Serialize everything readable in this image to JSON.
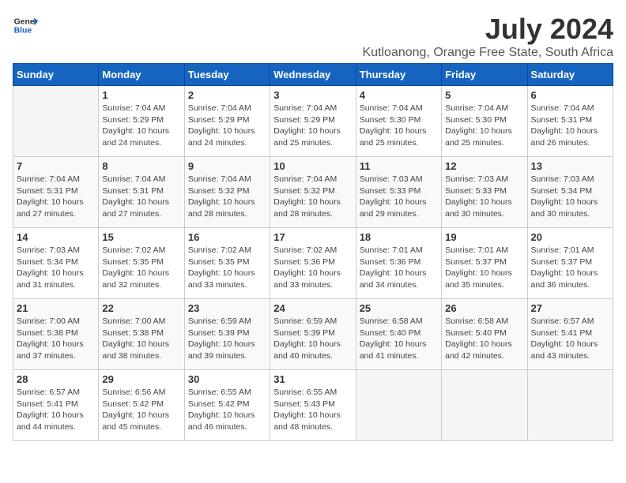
{
  "header": {
    "logo_general": "General",
    "logo_blue": "Blue",
    "main_title": "July 2024",
    "subtitle": "Kutloanong, Orange Free State, South Africa"
  },
  "days_of_week": [
    "Sunday",
    "Monday",
    "Tuesday",
    "Wednesday",
    "Thursday",
    "Friday",
    "Saturday"
  ],
  "weeks": [
    [
      {
        "day": "",
        "sunrise": "",
        "sunset": "",
        "daylight": ""
      },
      {
        "day": "1",
        "sunrise": "Sunrise: 7:04 AM",
        "sunset": "Sunset: 5:29 PM",
        "daylight": "Daylight: 10 hours and 24 minutes."
      },
      {
        "day": "2",
        "sunrise": "Sunrise: 7:04 AM",
        "sunset": "Sunset: 5:29 PM",
        "daylight": "Daylight: 10 hours and 24 minutes."
      },
      {
        "day": "3",
        "sunrise": "Sunrise: 7:04 AM",
        "sunset": "Sunset: 5:29 PM",
        "daylight": "Daylight: 10 hours and 25 minutes."
      },
      {
        "day": "4",
        "sunrise": "Sunrise: 7:04 AM",
        "sunset": "Sunset: 5:30 PM",
        "daylight": "Daylight: 10 hours and 25 minutes."
      },
      {
        "day": "5",
        "sunrise": "Sunrise: 7:04 AM",
        "sunset": "Sunset: 5:30 PM",
        "daylight": "Daylight: 10 hours and 25 minutes."
      },
      {
        "day": "6",
        "sunrise": "Sunrise: 7:04 AM",
        "sunset": "Sunset: 5:31 PM",
        "daylight": "Daylight: 10 hours and 26 minutes."
      }
    ],
    [
      {
        "day": "7",
        "sunrise": "Sunrise: 7:04 AM",
        "sunset": "Sunset: 5:31 PM",
        "daylight": "Daylight: 10 hours and 27 minutes."
      },
      {
        "day": "8",
        "sunrise": "Sunrise: 7:04 AM",
        "sunset": "Sunset: 5:31 PM",
        "daylight": "Daylight: 10 hours and 27 minutes."
      },
      {
        "day": "9",
        "sunrise": "Sunrise: 7:04 AM",
        "sunset": "Sunset: 5:32 PM",
        "daylight": "Daylight: 10 hours and 28 minutes."
      },
      {
        "day": "10",
        "sunrise": "Sunrise: 7:04 AM",
        "sunset": "Sunset: 5:32 PM",
        "daylight": "Daylight: 10 hours and 28 minutes."
      },
      {
        "day": "11",
        "sunrise": "Sunrise: 7:03 AM",
        "sunset": "Sunset: 5:33 PM",
        "daylight": "Daylight: 10 hours and 29 minutes."
      },
      {
        "day": "12",
        "sunrise": "Sunrise: 7:03 AM",
        "sunset": "Sunset: 5:33 PM",
        "daylight": "Daylight: 10 hours and 30 minutes."
      },
      {
        "day": "13",
        "sunrise": "Sunrise: 7:03 AM",
        "sunset": "Sunset: 5:34 PM",
        "daylight": "Daylight: 10 hours and 30 minutes."
      }
    ],
    [
      {
        "day": "14",
        "sunrise": "Sunrise: 7:03 AM",
        "sunset": "Sunset: 5:34 PM",
        "daylight": "Daylight: 10 hours and 31 minutes."
      },
      {
        "day": "15",
        "sunrise": "Sunrise: 7:02 AM",
        "sunset": "Sunset: 5:35 PM",
        "daylight": "Daylight: 10 hours and 32 minutes."
      },
      {
        "day": "16",
        "sunrise": "Sunrise: 7:02 AM",
        "sunset": "Sunset: 5:35 PM",
        "daylight": "Daylight: 10 hours and 33 minutes."
      },
      {
        "day": "17",
        "sunrise": "Sunrise: 7:02 AM",
        "sunset": "Sunset: 5:36 PM",
        "daylight": "Daylight: 10 hours and 33 minutes."
      },
      {
        "day": "18",
        "sunrise": "Sunrise: 7:01 AM",
        "sunset": "Sunset: 5:36 PM",
        "daylight": "Daylight: 10 hours and 34 minutes."
      },
      {
        "day": "19",
        "sunrise": "Sunrise: 7:01 AM",
        "sunset": "Sunset: 5:37 PM",
        "daylight": "Daylight: 10 hours and 35 minutes."
      },
      {
        "day": "20",
        "sunrise": "Sunrise: 7:01 AM",
        "sunset": "Sunset: 5:37 PM",
        "daylight": "Daylight: 10 hours and 36 minutes."
      }
    ],
    [
      {
        "day": "21",
        "sunrise": "Sunrise: 7:00 AM",
        "sunset": "Sunset: 5:38 PM",
        "daylight": "Daylight: 10 hours and 37 minutes."
      },
      {
        "day": "22",
        "sunrise": "Sunrise: 7:00 AM",
        "sunset": "Sunset: 5:38 PM",
        "daylight": "Daylight: 10 hours and 38 minutes."
      },
      {
        "day": "23",
        "sunrise": "Sunrise: 6:59 AM",
        "sunset": "Sunset: 5:39 PM",
        "daylight": "Daylight: 10 hours and 39 minutes."
      },
      {
        "day": "24",
        "sunrise": "Sunrise: 6:59 AM",
        "sunset": "Sunset: 5:39 PM",
        "daylight": "Daylight: 10 hours and 40 minutes."
      },
      {
        "day": "25",
        "sunrise": "Sunrise: 6:58 AM",
        "sunset": "Sunset: 5:40 PM",
        "daylight": "Daylight: 10 hours and 41 minutes."
      },
      {
        "day": "26",
        "sunrise": "Sunrise: 6:58 AM",
        "sunset": "Sunset: 5:40 PM",
        "daylight": "Daylight: 10 hours and 42 minutes."
      },
      {
        "day": "27",
        "sunrise": "Sunrise: 6:57 AM",
        "sunset": "Sunset: 5:41 PM",
        "daylight": "Daylight: 10 hours and 43 minutes."
      }
    ],
    [
      {
        "day": "28",
        "sunrise": "Sunrise: 6:57 AM",
        "sunset": "Sunset: 5:41 PM",
        "daylight": "Daylight: 10 hours and 44 minutes."
      },
      {
        "day": "29",
        "sunrise": "Sunrise: 6:56 AM",
        "sunset": "Sunset: 5:42 PM",
        "daylight": "Daylight: 10 hours and 45 minutes."
      },
      {
        "day": "30",
        "sunrise": "Sunrise: 6:55 AM",
        "sunset": "Sunset: 5:42 PM",
        "daylight": "Daylight: 10 hours and 46 minutes."
      },
      {
        "day": "31",
        "sunrise": "Sunrise: 6:55 AM",
        "sunset": "Sunset: 5:43 PM",
        "daylight": "Daylight: 10 hours and 48 minutes."
      },
      {
        "day": "",
        "sunrise": "",
        "sunset": "",
        "daylight": ""
      },
      {
        "day": "",
        "sunrise": "",
        "sunset": "",
        "daylight": ""
      },
      {
        "day": "",
        "sunrise": "",
        "sunset": "",
        "daylight": ""
      }
    ]
  ]
}
